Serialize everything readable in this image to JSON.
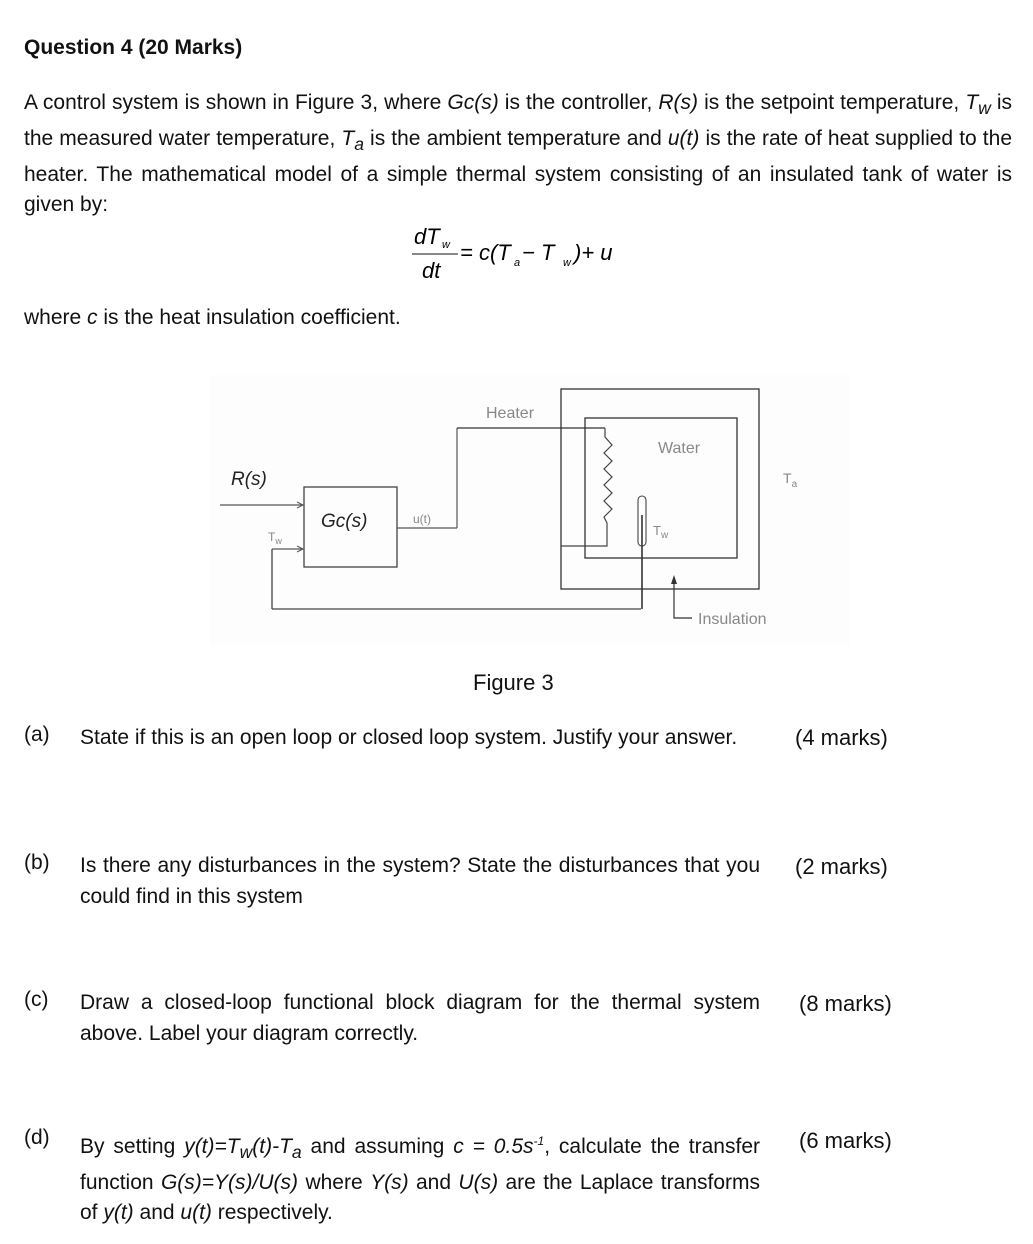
{
  "title": "Question 4 (20 Marks)",
  "intro": {
    "p1": "A control system is shown in Figure 3, where ",
    "gc": "Gc(s)",
    "p2": " is the controller, ",
    "rs": "R(s)",
    "p3": " is the setpoint temperature, ",
    "tw": "T",
    "tw_sub": "w",
    "p4": " is the measured water temperature, ",
    "ta": "T",
    "ta_sub": "a",
    "p5": " is the ambient temperature and ",
    "ut": "u(t)",
    "p6": " is the rate of heat supplied to the heater. The mathematical model of a simple thermal system consisting of an insulated tank of water is given by:"
  },
  "equation": {
    "numerator": "dT",
    "numerator_sub": "w",
    "denominator": "dt",
    "rhs": "= c(T",
    "rhs_sub_a": "a",
    "rhs_mid": " − T",
    "rhs_sub_w": "w",
    "rhs_end": ")+ u"
  },
  "where_text": {
    "p1": "where ",
    "c": "c",
    "p2": " is the heat insulation coefficient."
  },
  "figure": {
    "caption": "Figure 3",
    "labels": {
      "rs": "R(s)",
      "gc": "Gc(s)",
      "ut": "u(t)",
      "tw_in": "T",
      "tw_in_sub": "w",
      "heater": "Heater",
      "water": "Water",
      "tw_probe": "T",
      "tw_probe_sub": "w",
      "ta": "T",
      "ta_sub": "a",
      "insulation": "Insulation"
    }
  },
  "questions": [
    {
      "label": "(a)",
      "text": "State if this is an open loop or closed loop system. Justify your answer.",
      "marks": "(4 marks)"
    },
    {
      "label": "(b)",
      "text": "Is there any disturbances in the system? State the disturbances that you could find in this system",
      "marks": "(2 marks)"
    },
    {
      "label": "(c)",
      "text": "Draw a closed-loop functional block diagram for the thermal system above. Label your diagram correctly.",
      "marks": "(8 marks)"
    },
    {
      "label": "(d)",
      "text_parts": {
        "a": "By setting ",
        "yt": "y(t)=T",
        "yt_sub": "w",
        "yt2": "(t)-T",
        "yt_sub2": "a",
        "b": " and assuming ",
        "c": "c = 0.5s",
        "c_sup": "-1",
        "d": ", calculate the transfer function ",
        "gs": "G(s)=Y(s)/U(s)",
        "e": " where ",
        "ys": "Y(s)",
        "f": " and ",
        "us": "U(s)",
        "g": " are the Laplace transforms of ",
        "y": "y(t)",
        "h": " and ",
        "u": "u(t)",
        "i": " respectively."
      },
      "marks": "(6 marks)"
    }
  ]
}
